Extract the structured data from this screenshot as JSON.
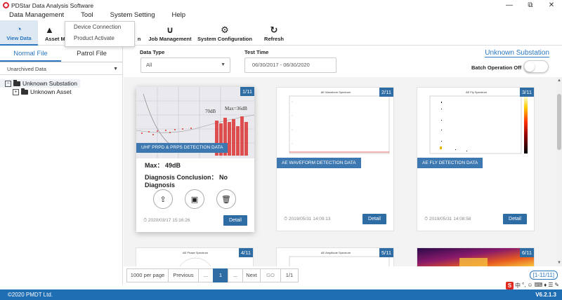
{
  "window": {
    "title": "PDStar Data Analysis Software",
    "minimize": "—",
    "restore": "⧉",
    "close": "✕"
  },
  "menu": [
    "Data Management",
    "Tool",
    "System Setting",
    "Help"
  ],
  "toolbar": {
    "view_data": "View Data",
    "asset_mgmt": "Asset Ma",
    "hidden_partial": "n",
    "job_management": "Job Management",
    "system_configuration": "System Configuration",
    "refresh": "Refresh"
  },
  "tool_dropdown": [
    "Device Connection",
    "Product Activate"
  ],
  "sidebar": {
    "tabs": [
      "Normal File",
      "Patrol File"
    ],
    "archive_filter": "Unarchived Data",
    "tree": {
      "root": "Unknown Substation",
      "child": "Unknown Asset"
    }
  },
  "filters": {
    "data_type_label": "Data Type",
    "data_type_value": "All",
    "test_time_label": "Test Time",
    "test_time_value": "06/30/2017 - 06/30/2020",
    "substation_link": "Unknown Substation",
    "batch_label": "Batch Operation Off",
    "batch_on": false
  },
  "cards": [
    {
      "num": "1/11",
      "tag": "UHF PRPD & PRPS DETECTION DATA",
      "max": "Max：  49dB",
      "diagnosis": "Diagnosis Conclusion：  No Diagnosis",
      "date": "2020/03/17 15:16:26",
      "detail": "Detail",
      "chart_labels": [
        "70dB",
        "Max=36dB"
      ]
    },
    {
      "num": "2/11",
      "tag": "AE WAVEFORM DETECTION DATA",
      "chart_title": "AE Waveform Spectrum",
      "date": "2019/05/31 14:09:13",
      "detail": "Detail"
    },
    {
      "num": "3/11",
      "tag": "AE FLY DETECTION DATA",
      "chart_title": "AE Fly Spectrum",
      "date": "2019/05/31 14:08:58",
      "detail": "Detail"
    },
    {
      "num": "4/11",
      "chart_title": "AE Phase Spectrum"
    },
    {
      "num": "5/11",
      "chart_title": "AE Amplitude Spectrum"
    },
    {
      "num": "6/11"
    }
  ],
  "pagination": {
    "per_page": "1000 per page",
    "previous": "Previous",
    "ellipsis_left": "...",
    "current": "1",
    "ellipsis_right": "...",
    "next": "Next",
    "go": "GO",
    "total": "1/1",
    "range": "[1-11/11]"
  },
  "footer": {
    "copyright": "©2020 PMDT Ltd.",
    "version": "V6.2.1.3"
  },
  "ime": [
    "S",
    "中",
    "°,",
    "☺",
    "⌨",
    "♦",
    "☰",
    "✎"
  ]
}
